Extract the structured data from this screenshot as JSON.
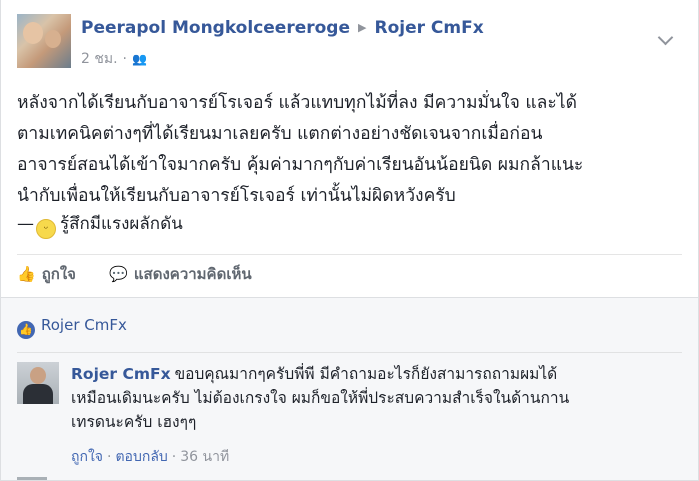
{
  "post": {
    "author": "Peerapol Mongkolceereroge",
    "target": "Rojer CmFx",
    "time": "2 ชม.",
    "privacy_icon": "friends-icon",
    "text_lines": [
      "หลังจากได้เรียนกับอาจารย์โรเจอร์ แล้วแทบทุกไม้ที่ลง มีความมั่นใจ และได้",
      "ตามเทคนิคต่างๆที่ได้เรียนมาเลยครับ แตกต่างอย่างชัดเจนจากเมื่อก่อน",
      "อาจารย์สอนได้เข้าใจมากครับ คุ้มค่ามากๆกับค่าเรียนอันน้อยนิด ผมกล้าแนะ",
      "นำกับเพื่อนให้เรียนกับอาจารย์โรเจอร์ เท่านั้นไม่ผิดหวังครับ"
    ],
    "feeling_prefix": "—",
    "feeling": "รู้สึกมีแรงผลักดัน"
  },
  "actions": {
    "like": "ถูกใจ",
    "comment": "แสดงความคิดเห็น"
  },
  "likes": {
    "names": "Rojer CmFx"
  },
  "comment": {
    "author": "Rojer CmFx",
    "line1": "ขอบคุณมากๆครับพี่พี มีคำถามอะไรก็ยังสามารถถามผมได้",
    "line2": "เหมือนเดิมนะครับ ไม่ต้องเกรงใจ ผมก็ขอให้พี่ประสบความสำเร็จในด้านกาน",
    "line3": "เทรดนะครับ เฮงๆๆ",
    "like": "ถูกใจ",
    "reply": "ตอบกลับ",
    "time": "36 นาที"
  },
  "colors": {
    "link": "#365899",
    "background": "#e9ebee",
    "like_badge": "#4267b2"
  }
}
